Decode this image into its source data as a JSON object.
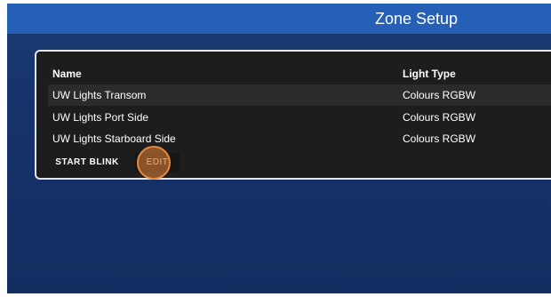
{
  "header": {
    "title": "Zone Setup"
  },
  "table": {
    "columns": {
      "name": "Name",
      "light_type": "Light Type"
    },
    "rows": [
      {
        "name": "UW Lights Transom",
        "light_type": "Colours RGBW"
      },
      {
        "name": "UW Lights Port Side",
        "light_type": "Colours RGBW"
      },
      {
        "name": "UW Lights Starboard Side",
        "light_type": "Colours RGBW"
      }
    ]
  },
  "actions": {
    "start_blink": "START BLINK",
    "edit": "EDIT"
  },
  "colors": {
    "titlebar": "#2560b6",
    "background": "#16336a",
    "panel": "#1d1d1d",
    "panel_border": "#e6e6e6",
    "click_highlight": "#e88a3c"
  }
}
